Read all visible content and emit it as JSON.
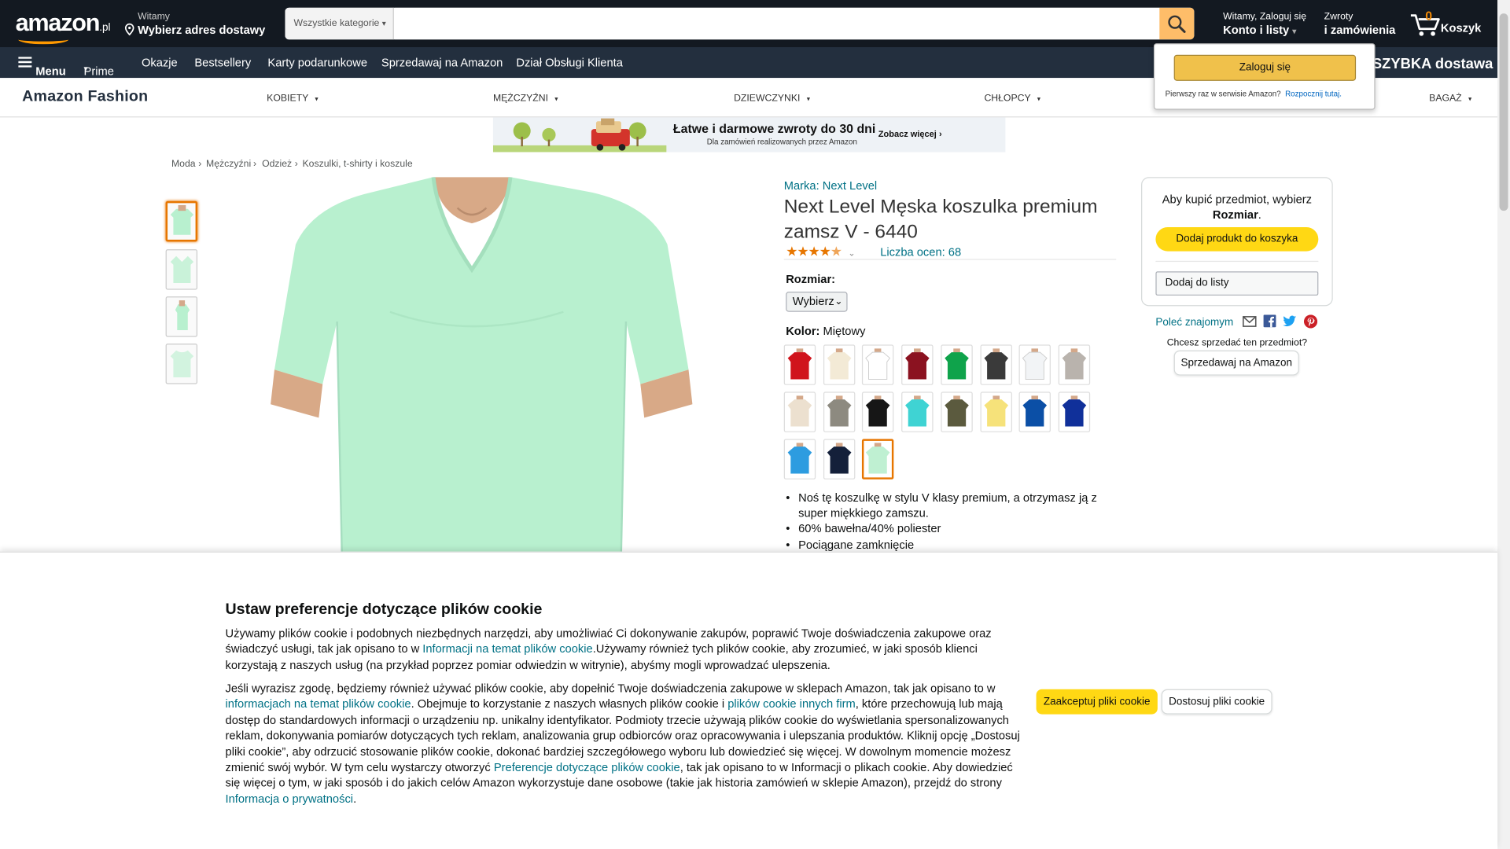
{
  "header": {
    "logo": "amazon",
    "logo_tld": ".pl",
    "deliver_line1": "Witamy",
    "deliver_line2": "Wybierz adres dostawy",
    "search_category": "Wszystkie kategorie",
    "search_placeholder": "",
    "account_line1": "Witamy, Zaloguj się",
    "account_line2": "Konto i listy",
    "returns_line1": "Zwroty",
    "returns_line2": "i zamówienia",
    "cart_count": "0",
    "cart_label": "Koszyk"
  },
  "subnav": {
    "menu": "Menu",
    "items": [
      "Prime",
      "Okazje",
      "Bestsellery",
      "Karty podarunkowe",
      "Sprzedawaj na Amazon",
      "Dział Obsługi Klienta"
    ],
    "promo": "SZYBKA dostawa"
  },
  "signin_flyout": {
    "button": "Zaloguj się",
    "text": "Pierwszy raz w serwisie Amazon?",
    "link": "Rozpocznij tutaj."
  },
  "fashion": {
    "brand": "Amazon Fashion",
    "categories": [
      "KOBIETY",
      "MĘŻCZYŹNI",
      "DZIEWCZYNKI",
      "CHŁOPCY",
      "BAGAŻ"
    ]
  },
  "banner": {
    "title": "Łatwe i darmowe zwroty do 30 dni",
    "subtitle": "Dla zamówień realizowanych przez Amazon",
    "cta": "Zobacz więcej"
  },
  "breadcrumb": [
    "Moda",
    "Mężczyźni",
    "Odzież",
    "Koszulki, t-shirty i koszule"
  ],
  "product": {
    "brand_link": "Marka: Next Level",
    "title": "Next Level Męska koszulka premium zamsz V - 6440",
    "rating": 4.5,
    "ratings_count": "Liczba ocen: 68",
    "size_label": "Rozmiar:",
    "size_value": "Wybierz",
    "color_label": "Kolor:",
    "color_value": "Miętowy",
    "swatches": [
      "#d0141c",
      "#f3ead6",
      "#ffffff",
      "#8b1220",
      "#0fa34b",
      "#3a3a3a",
      "#f2f4f6",
      "#b9b3ad",
      "#ece0cf",
      "#8d8a80",
      "#161616",
      "#3fd3d3",
      "#5b5a3e",
      "#f6e27a",
      "#0b4fa6",
      "#10309a",
      "#2d9ce0",
      "#14203a",
      "#bff0d2"
    ],
    "selected_swatch": 18,
    "shirt_color": "#b8f0cf",
    "bullets": [
      "Noś tę koszulkę w stylu V klasy premium, a otrzymasz ją z super miękkiego zamszu.",
      "60% bawełna/40% poliester",
      "Pociągane zamknięcie"
    ]
  },
  "buybox": {
    "prompt_1": "Aby kupić przedmiot, wybierz",
    "prompt_2": "Rozmiar",
    "prompt_end": ".",
    "add_to_cart": "Dodaj produkt do koszyka",
    "add_to_list": "Dodaj do listy",
    "share": "Poleć znajomym",
    "sell_question": "Chcesz sprzedać ten przedmiot?",
    "sell_button": "Sprzedawaj na Amazon"
  },
  "cookie": {
    "title": "Ustaw preferencje dotyczące plików cookie",
    "p1_a": "Używamy plików cookie i podobnych niezbędnych narzędzi, aby umożliwiać Ci dokonywanie zakupów, poprawić Twoje doświadczenia zakupowe oraz świadczyć usługi, tak jak opisano to w ",
    "p1_link": "Informacji na temat plików cookie",
    "p1_b": ".Używamy również tych plików cookie, aby zrozumieć, w jaki sposób klienci korzystają z naszych usług (na przykład poprzez pomiar odwiedzin w witrynie), abyśmy mogli wprowadzać ulepszenia.",
    "p2_a": "Jeśli wyrazisz zgodę, będziemy również używać plików cookie, aby dopełnić Twoje doświadczenia zakupowe w sklepach Amazon, tak jak opisano to w ",
    "p2_link1": "informacjach na temat plików cookie",
    "p2_b": ". Obejmuje to korzystanie z naszych własnych plików cookie i ",
    "p2_link2": "plików cookie innych firm",
    "p2_c": ", które przechowują lub mają dostęp do standardowych informacji o urządzeniu np. unikalny identyfikator. Podmioty trzecie używają plików cookie do wyświetlania spersonalizowanych reklam, dokonywania pomiarów dotyczących tych reklam, analizowania grup odbiorców oraz opracowywania i ulepszania produktów. Kliknij opcję „Dostosuj pliki cookie”, aby odrzucić stosowanie plików cookie, dokonać bardziej szczegółowego wyboru lub dowiedzieć się więcej. W dowolnym momencie możesz zmienić swój wybór. W tym celu wystarczy otworzyć ",
    "p2_link3": "Preferencje dotyczące plików cookie",
    "p2_d": ", tak jak opisano to w Informacji o plikach cookie. Aby dowiedzieć się więcej o tym, w jaki sposób i do jakich celów Amazon wykorzystuje dane osobowe (takie jak historia zamówień w sklepie Amazon), przejdź do strony ",
    "p2_link4": "Informacja o prywatności",
    "p2_e": ".",
    "accept": "Zaakceptuj pliki cookie",
    "customize": "Dostosuj pliki cookie"
  }
}
